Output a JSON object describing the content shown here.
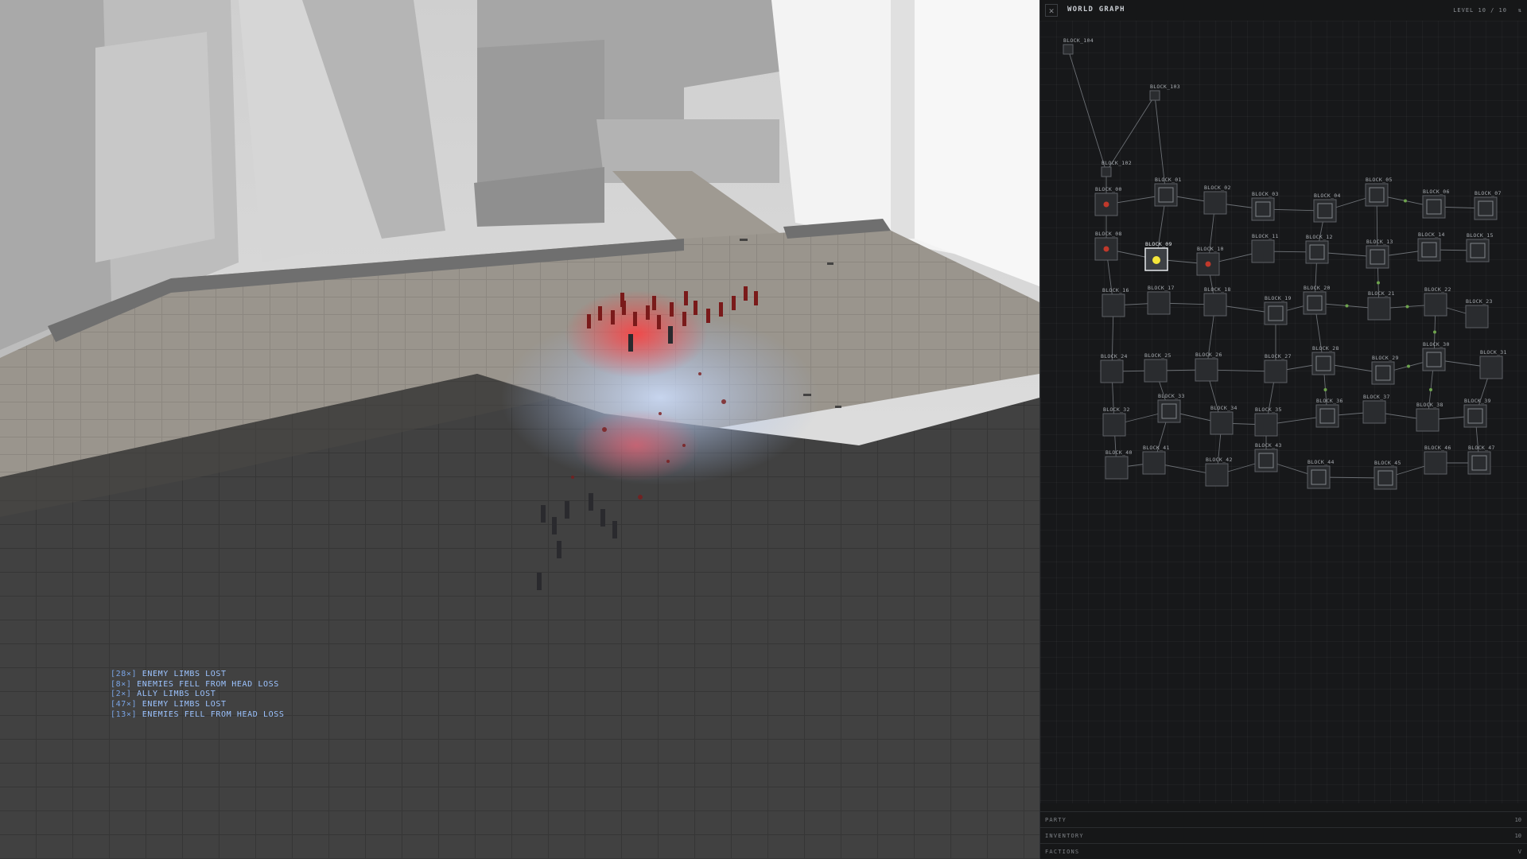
{
  "combat_log": [
    {
      "count": "[28×]",
      "text": "ENEMY LIMBS LOST"
    },
    {
      "count": "[8×]",
      "text": "ENEMIES FELL FROM HEAD LOSS"
    },
    {
      "count": "[2×]",
      "text": "ALLY LIMBS LOST"
    },
    {
      "count": "[47×]",
      "text": "ENEMY LIMBS LOST"
    },
    {
      "count": "[13×]",
      "text": "ENEMIES FELL FROM HEAD LOSS"
    }
  ],
  "panel": {
    "close_glyph": "✕",
    "title": "WORLD GRAPH",
    "level": "LEVEL 10 / 10",
    "pin_glyph": "⇅"
  },
  "sections": [
    {
      "label": "PARTY",
      "value": "10"
    },
    {
      "label": "INVENTORY",
      "value": "10"
    },
    {
      "label": "FACTIONS",
      "value": "V"
    }
  ],
  "graph": {
    "current_node": "BLOCK_09",
    "nodes": [
      "BLOCK_104",
      "BLOCK_103",
      "BLOCK_102",
      "BLOCK_00",
      "BLOCK_01",
      "BLOCK_02",
      "BLOCK_03",
      "BLOCK_04",
      "BLOCK_05",
      "BLOCK_06",
      "BLOCK_07",
      "BLOCK_08",
      "BLOCK_09",
      "BLOCK_10",
      "BLOCK_11",
      "BLOCK_12",
      "BLOCK_13",
      "BLOCK_14",
      "BLOCK_15",
      "BLOCK_16",
      "BLOCK_17",
      "BLOCK_18",
      "BLOCK_19",
      "BLOCK_20",
      "BLOCK_21",
      "BLOCK_22",
      "BLOCK_23",
      "BLOCK_24",
      "BLOCK_25",
      "BLOCK_26",
      "BLOCK_27",
      "BLOCK_28",
      "BLOCK_29",
      "BLOCK_30",
      "BLOCK_31",
      "BLOCK_32",
      "BLOCK_33",
      "BLOCK_34",
      "BLOCK_35",
      "BLOCK_36",
      "BLOCK_37",
      "BLOCK_38",
      "BLOCK_39",
      "BLOCK_40",
      "BLOCK_41",
      "BLOCK_42",
      "BLOCK_43",
      "BLOCK_44",
      "BLOCK_45",
      "BLOCK_46",
      "BLOCK_47"
    ]
  },
  "colors": {
    "current_marker": "#f5e63a",
    "enemy_marker": "#c0392b",
    "path_dot": "#6da34d"
  }
}
